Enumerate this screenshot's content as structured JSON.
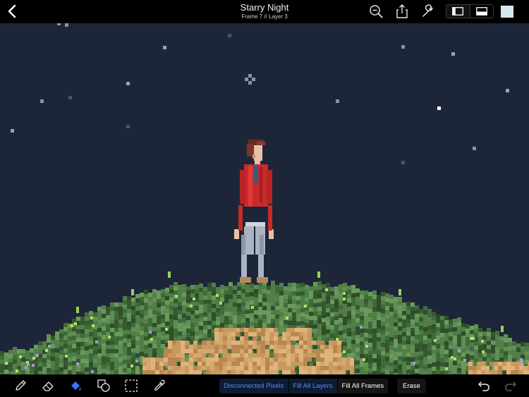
{
  "header": {
    "back_icon": "chevron-left-icon",
    "title": "Starry Night",
    "subtitle": "Frame 7 // Layer 3",
    "icons": [
      "zoom-icon",
      "share-icon",
      "wrench-icon"
    ],
    "view_toggle": [
      "sidebar-view-icon",
      "timeline-view-icon"
    ],
    "current_color": "#d5e8ef"
  },
  "toolbar": {
    "tools": [
      "pencil-icon",
      "eraser-icon",
      "fill-bucket-icon",
      "shapes-icon",
      "selection-icon",
      "eyedropper-icon"
    ],
    "active_tool": "fill-bucket-icon",
    "fill_modes": [
      {
        "label": "Disconnected Pixels",
        "active": true
      },
      {
        "label": "Fill All Layers",
        "active": true
      },
      {
        "label": "Fill All Frames",
        "active": false
      }
    ],
    "erase_label": "Erase",
    "undo_icon": "undo-icon",
    "redo_icon": "redo-icon"
  },
  "canvas": {
    "sky_color": "#1d2639",
    "accent_color": "#3478f6"
  }
}
